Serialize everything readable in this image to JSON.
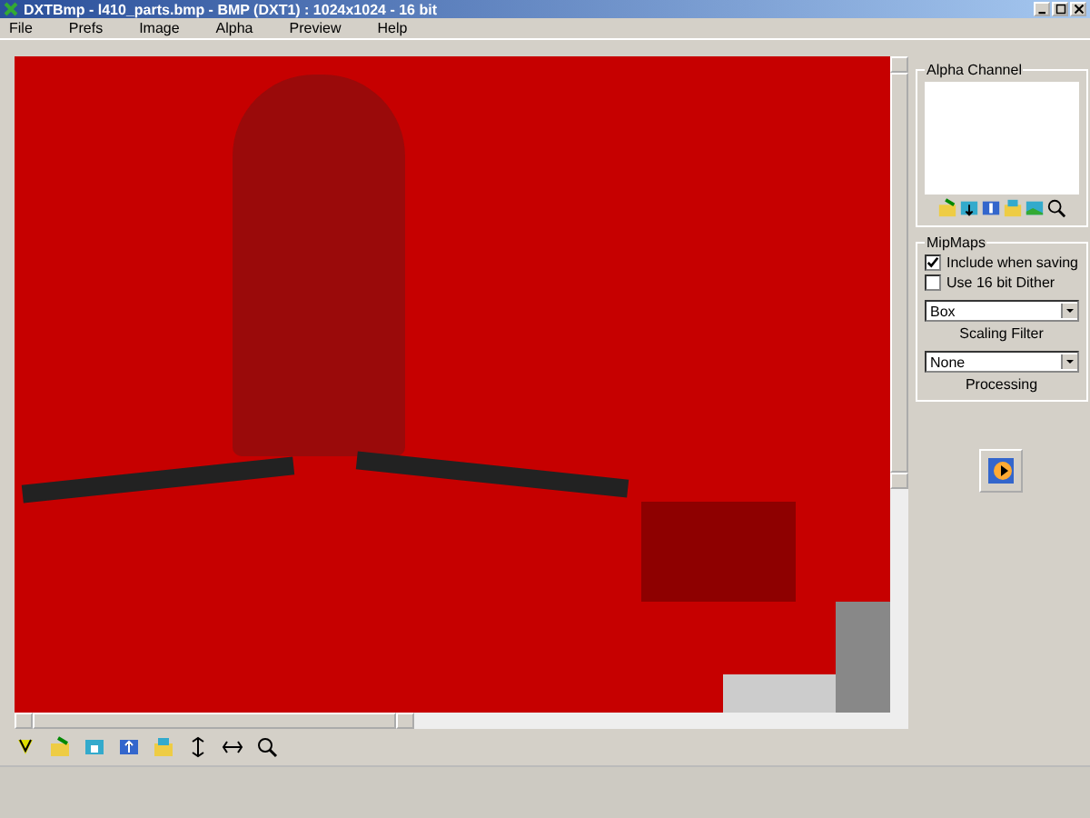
{
  "window": {
    "title": "DXTBmp - l410_parts.bmp - BMP (DXT1) : 1024x1024 - 16 bit"
  },
  "menu": [
    "File",
    "Prefs",
    "Image",
    "Alpha",
    "Preview",
    "Help"
  ],
  "alpha_channel": {
    "title": "Alpha Channel"
  },
  "mipmaps": {
    "title": "MipMaps",
    "options": [
      {
        "label": "Include when saving",
        "checked": true
      },
      {
        "label": "Use 16 bit Dither",
        "checked": false
      }
    ],
    "scaling_filter": {
      "value": "Box",
      "label": "Scaling Filter"
    },
    "processing": {
      "value": "None",
      "label": "Processing"
    }
  }
}
